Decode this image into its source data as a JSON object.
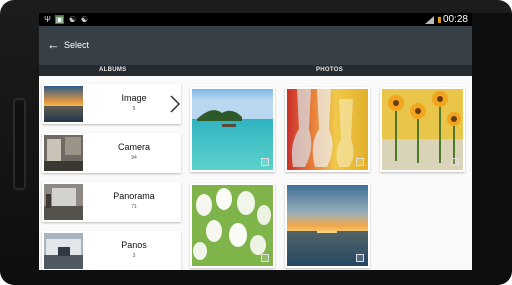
{
  "statusbar": {
    "time": "00:28",
    "icons": [
      "usb-icon",
      "image-notification-icon",
      "cat-icon",
      "cat-icon",
      "signal-icon",
      "battery-icon"
    ]
  },
  "actionbar": {
    "title": "Select",
    "back_icon": "arrow-left-icon"
  },
  "tabs": {
    "albums": "ALBUMS",
    "photos": "PHOTOS"
  },
  "albums": [
    {
      "name": "Image",
      "count": "5"
    },
    {
      "name": "Camera",
      "count": "94"
    },
    {
      "name": "Panorama",
      "count": "71"
    },
    {
      "name": "Panos",
      "count": "3"
    }
  ],
  "photos": [
    {
      "subject": "tropical beach"
    },
    {
      "subject": "glasses"
    },
    {
      "subject": "sunflowers"
    },
    {
      "subject": "white tulips"
    },
    {
      "subject": "ocean sunset"
    }
  ],
  "colors": {
    "actionbar": "#374047",
    "tabbar": "#262b2f"
  }
}
